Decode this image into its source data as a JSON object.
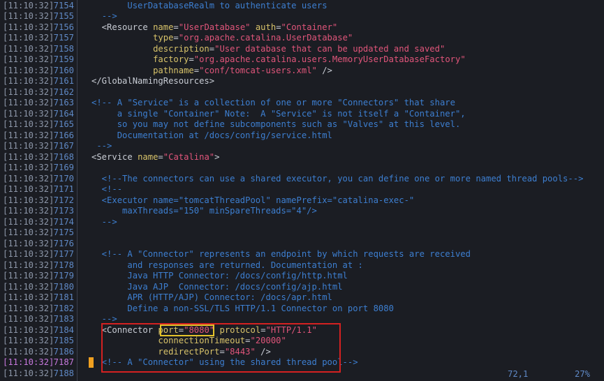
{
  "lines": [
    {
      "ts": "[11:10:32]",
      "ln": "7154",
      "code": [
        {
          "t": "          ",
          "c": "t"
        },
        {
          "t": "UserDatabaseRealm to authenticate users",
          "c": "c"
        }
      ]
    },
    {
      "ts": "[11:10:32]",
      "ln": "7155",
      "code": [
        {
          "t": "     ",
          "c": "t"
        },
        {
          "t": "-->",
          "c": "c"
        }
      ]
    },
    {
      "ts": "[11:10:32]",
      "ln": "7156",
      "code": [
        {
          "t": "     <Resource ",
          "c": "t"
        },
        {
          "t": "name",
          "c": "a"
        },
        {
          "t": "=",
          "c": "t"
        },
        {
          "t": "\"UserDatabase\"",
          "c": "s"
        },
        {
          "t": " ",
          "c": "t"
        },
        {
          "t": "auth",
          "c": "a"
        },
        {
          "t": "=",
          "c": "t"
        },
        {
          "t": "\"Container\"",
          "c": "s"
        }
      ]
    },
    {
      "ts": "[11:10:32]",
      "ln": "7157",
      "code": [
        {
          "t": "               ",
          "c": "t"
        },
        {
          "t": "type",
          "c": "a"
        },
        {
          "t": "=",
          "c": "t"
        },
        {
          "t": "\"org.apache.catalina.UserDatabase\"",
          "c": "s"
        }
      ]
    },
    {
      "ts": "[11:10:32]",
      "ln": "7158",
      "code": [
        {
          "t": "               ",
          "c": "t"
        },
        {
          "t": "description",
          "c": "a"
        },
        {
          "t": "=",
          "c": "t"
        },
        {
          "t": "\"User database that can be updated and saved\"",
          "c": "s"
        }
      ]
    },
    {
      "ts": "[11:10:32]",
      "ln": "7159",
      "code": [
        {
          "t": "               ",
          "c": "t"
        },
        {
          "t": "factory",
          "c": "a"
        },
        {
          "t": "=",
          "c": "t"
        },
        {
          "t": "\"org.apache.catalina.users.MemoryUserDatabaseFactory\"",
          "c": "s"
        }
      ]
    },
    {
      "ts": "[11:10:32]",
      "ln": "7160",
      "code": [
        {
          "t": "               ",
          "c": "t"
        },
        {
          "t": "pathname",
          "c": "a"
        },
        {
          "t": "=",
          "c": "t"
        },
        {
          "t": "\"conf/tomcat-users.xml\"",
          "c": "s"
        },
        {
          "t": " />",
          "c": "t"
        }
      ]
    },
    {
      "ts": "[11:10:32]",
      "ln": "7161",
      "code": [
        {
          "t": "   </GlobalNamingResources>",
          "c": "t"
        }
      ]
    },
    {
      "ts": "[11:10:32]",
      "ln": "7162",
      "code": []
    },
    {
      "ts": "[11:10:32]",
      "ln": "7163",
      "code": [
        {
          "t": "   <!-- A \"Service\" is a collection of one or more \"Connectors\" that share",
          "c": "c"
        }
      ]
    },
    {
      "ts": "[11:10:32]",
      "ln": "7164",
      "code": [
        {
          "t": "        a single \"Container\" Note:  A \"Service\" is not itself a \"Container\",",
          "c": "c"
        }
      ]
    },
    {
      "ts": "[11:10:32]",
      "ln": "7165",
      "code": [
        {
          "t": "        so you may not define subcomponents such as \"Valves\" at this level.",
          "c": "c"
        }
      ]
    },
    {
      "ts": "[11:10:32]",
      "ln": "7166",
      "code": [
        {
          "t": "        Documentation at /docs/config/service.html",
          "c": "c"
        }
      ]
    },
    {
      "ts": "[11:10:32]",
      "ln": "7167",
      "code": [
        {
          "t": "    -->",
          "c": "c"
        }
      ]
    },
    {
      "ts": "[11:10:32]",
      "ln": "7168",
      "code": [
        {
          "t": "   <Service ",
          "c": "t"
        },
        {
          "t": "name",
          "c": "a"
        },
        {
          "t": "=",
          "c": "t"
        },
        {
          "t": "\"Catalina\"",
          "c": "s"
        },
        {
          "t": ">",
          "c": "t"
        }
      ]
    },
    {
      "ts": "[11:10:32]",
      "ln": "7169",
      "code": []
    },
    {
      "ts": "[11:10:32]",
      "ln": "7170",
      "code": [
        {
          "t": "     <!--The connectors can use a shared executor, you can define one or more named thread pools-->",
          "c": "c"
        }
      ]
    },
    {
      "ts": "[11:10:32]",
      "ln": "7171",
      "code": [
        {
          "t": "     <!--",
          "c": "c"
        }
      ]
    },
    {
      "ts": "[11:10:32]",
      "ln": "7172",
      "code": [
        {
          "t": "     <Executor name=\"tomcatThreadPool\" namePrefix=\"catalina-exec-\"",
          "c": "c"
        }
      ]
    },
    {
      "ts": "[11:10:32]",
      "ln": "7173",
      "code": [
        {
          "t": "         maxThreads=\"150\" minSpareThreads=\"4\"/>",
          "c": "c"
        }
      ]
    },
    {
      "ts": "[11:10:32]",
      "ln": "7174",
      "code": [
        {
          "t": "     -->",
          "c": "c"
        }
      ]
    },
    {
      "ts": "[11:10:32]",
      "ln": "7175",
      "code": []
    },
    {
      "ts": "[11:10:32]",
      "ln": "7176",
      "code": []
    },
    {
      "ts": "[11:10:32]",
      "ln": "7177",
      "code": [
        {
          "t": "     <!-- A \"Connector\" represents an endpoint by which requests are received",
          "c": "c"
        }
      ]
    },
    {
      "ts": "[11:10:32]",
      "ln": "7178",
      "code": [
        {
          "t": "          and responses are returned. Documentation at :",
          "c": "c"
        }
      ]
    },
    {
      "ts": "[11:10:32]",
      "ln": "7179",
      "code": [
        {
          "t": "          Java HTTP Connector: /docs/config/http.html",
          "c": "c"
        }
      ]
    },
    {
      "ts": "[11:10:32]",
      "ln": "7180",
      "code": [
        {
          "t": "          Java AJP  Connector: /docs/config/ajp.html",
          "c": "c"
        }
      ]
    },
    {
      "ts": "[11:10:32]",
      "ln": "7181",
      "code": [
        {
          "t": "          APR (HTTP/AJP) Connector: /docs/apr.html",
          "c": "c"
        }
      ]
    },
    {
      "ts": "[11:10:32]",
      "ln": "7182",
      "code": [
        {
          "t": "          Define a non-SSL/TLS HTTP/1.1 Connector on port 8080",
          "c": "c"
        }
      ]
    },
    {
      "ts": "[11:10:32]",
      "ln": "7183",
      "code": [
        {
          "t": "     -->",
          "c": "c"
        }
      ]
    },
    {
      "ts": "[11:10:32]",
      "ln": "7184",
      "code": [
        {
          "t": "     <Connector ",
          "c": "t"
        },
        {
          "t": "port",
          "c": "a"
        },
        {
          "t": "=",
          "c": "t"
        },
        {
          "t": "\"8080\"",
          "c": "s"
        },
        {
          "t": " ",
          "c": "t"
        },
        {
          "t": "protocol",
          "c": "a"
        },
        {
          "t": "=",
          "c": "t"
        },
        {
          "t": "\"HTTP/1.1\"",
          "c": "s"
        }
      ]
    },
    {
      "ts": "[11:10:32]",
      "ln": "7185",
      "code": [
        {
          "t": "                ",
          "c": "t"
        },
        {
          "t": "connectionTimeout",
          "c": "a"
        },
        {
          "t": "=",
          "c": "t"
        },
        {
          "t": "\"20000\"",
          "c": "s"
        }
      ]
    },
    {
      "ts": "[11:10:32]",
      "ln": "7186",
      "code": [
        {
          "t": "                ",
          "c": "t"
        },
        {
          "t": "redirectPort",
          "c": "a"
        },
        {
          "t": "=",
          "c": "t"
        },
        {
          "t": "\"8443\"",
          "c": "s"
        },
        {
          "t": " />",
          "c": "t"
        }
      ]
    },
    {
      "ts": "[11:10:32]",
      "ln": "7187",
      "current": true,
      "code": [
        {
          "t": "     <!-- A \"Connector\" using the shared thread pool-->",
          "c": "c"
        }
      ]
    },
    {
      "ts": "[11:10:32]",
      "ln": "7188",
      "code": []
    }
  ],
  "status": {
    "position": "72,1",
    "percent": "27%"
  },
  "colors": {
    "background": "#1b1d23",
    "comment": "#3d7fd1",
    "attribute": "#d8c36a",
    "string": "#e0557a",
    "tag": "#c8ccd4",
    "highlight_box": "#d42121",
    "port_highlight": "#e3c22a",
    "cursor": "#f0a020"
  }
}
